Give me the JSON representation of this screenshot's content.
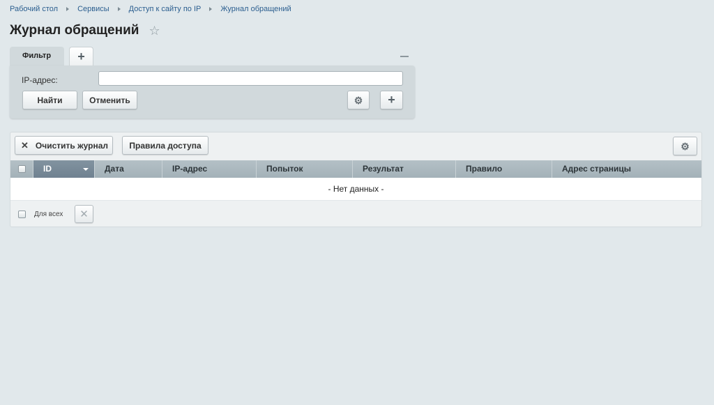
{
  "breadcrumb": [
    "Рабочий стол",
    "Сервисы",
    "Доступ к сайту по IP",
    "Журнал обращений"
  ],
  "page": {
    "title": "Журнал обращений"
  },
  "filter": {
    "tab_label": "Фильтр",
    "add_tab_label": "+",
    "ip_label": "IP-адрес:",
    "ip_value": "",
    "find_label": "Найти",
    "cancel_label": "Отменить",
    "add_field_label": "+"
  },
  "grid": {
    "clear_label": "Очистить журнал",
    "rules_label": "Правила доступа",
    "columns": [
      "ID",
      "Дата",
      "IP-адрес",
      "Попыток",
      "Результат",
      "Правило",
      "Адрес страницы"
    ],
    "sorted_column": "ID",
    "empty_text": "- Нет данных -",
    "for_all_label": "Для всех"
  },
  "icons": {
    "star": "star-icon",
    "gear": "gear-icon",
    "close": "close-icon"
  }
}
